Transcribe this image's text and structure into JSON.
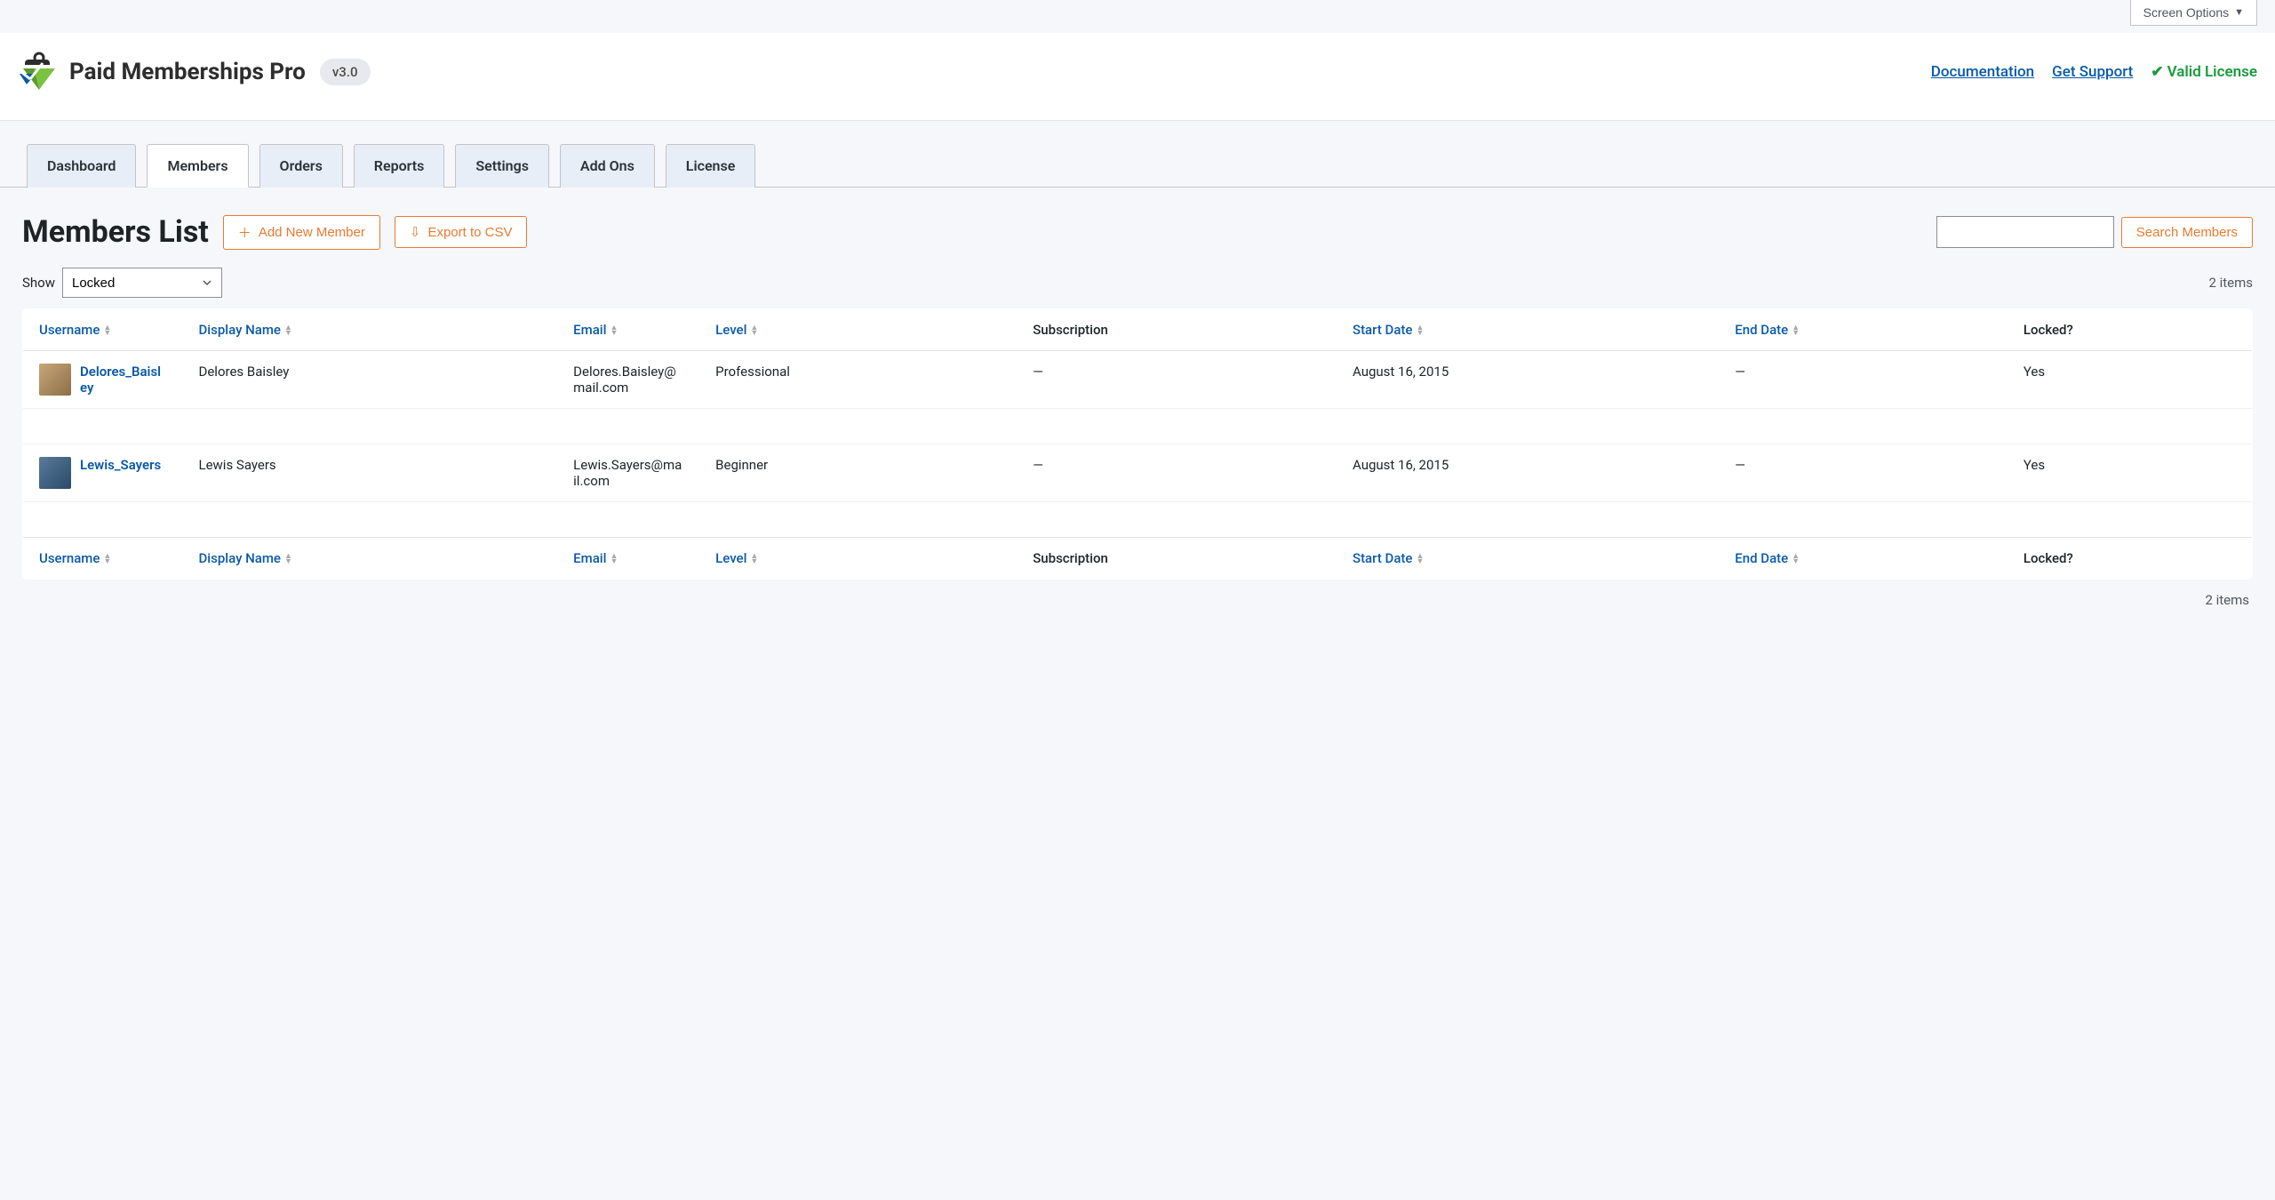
{
  "screen_options": "Screen Options",
  "brand": {
    "name": "Paid Memberships Pro",
    "version": "v3.0"
  },
  "header_links": {
    "documentation": "Documentation",
    "support": "Get Support",
    "valid_license": "Valid License"
  },
  "tabs": [
    {
      "label": "Dashboard"
    },
    {
      "label": "Members"
    },
    {
      "label": "Orders"
    },
    {
      "label": "Reports"
    },
    {
      "label": "Settings"
    },
    {
      "label": "Add Ons"
    },
    {
      "label": "License"
    }
  ],
  "page_title": "Members List",
  "buttons": {
    "add_new": "Add New Member",
    "export_csv": "Export to CSV",
    "search": "Search Members"
  },
  "filter": {
    "show_label": "Show",
    "selected": "Locked"
  },
  "items_count_top": "2 items",
  "items_count_bottom": "2 items",
  "columns": {
    "username": "Username",
    "display_name": "Display Name",
    "email": "Email",
    "level": "Level",
    "subscription": "Subscription",
    "start_date": "Start Date",
    "end_date": "End Date",
    "locked": "Locked?"
  },
  "rows": [
    {
      "username": "Delores_Baisley",
      "display_name": "Delores Baisley",
      "email": "Delores.Baisley@mail.com",
      "level": "Professional",
      "subscription": "—",
      "start_date": "August 16, 2015",
      "end_date": "—",
      "locked": "Yes"
    },
    {
      "username": "Lewis_Sayers",
      "display_name": "Lewis Sayers",
      "email": "Lewis.Sayers@mail.com",
      "level": "Beginner",
      "subscription": "—",
      "start_date": "August 16, 2015",
      "end_date": "—",
      "locked": "Yes"
    }
  ]
}
